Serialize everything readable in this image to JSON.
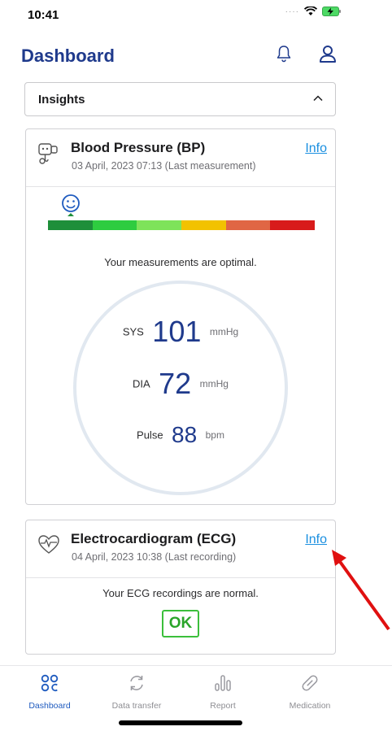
{
  "status": {
    "time": "10:41"
  },
  "header": {
    "title": "Dashboard"
  },
  "insights": {
    "label": "Insights"
  },
  "bp_card": {
    "title": "Blood Pressure (BP)",
    "subtitle": "03 April, 2023 07:13 (Last measurement)",
    "info": "Info",
    "message": "Your measurements are optimal.",
    "scale_colors": [
      "#1e8f3a",
      "#2ecc40",
      "#7ee35a",
      "#f2c200",
      "#e06644",
      "#d81b1b"
    ],
    "scale_level": 0,
    "sys": {
      "label": "SYS",
      "value": "101",
      "unit": "mmHg"
    },
    "dia": {
      "label": "DIA",
      "value": "72",
      "unit": "mmHg"
    },
    "pulse": {
      "label": "Pulse",
      "value": "88",
      "unit": "bpm"
    }
  },
  "ecg_card": {
    "title": "Electrocardiogram (ECG)",
    "subtitle": "04 April, 2023 10:38 (Last recording)",
    "info": "Info",
    "message": "Your ECG recordings are normal.",
    "badge": "OK"
  },
  "tabs": [
    {
      "label": "Dashboard",
      "icon": "dashboard-grid-icon",
      "active": true
    },
    {
      "label": "Data transfer",
      "icon": "sync-icon",
      "active": false
    },
    {
      "label": "Report",
      "icon": "bar-chart-icon",
      "active": false
    },
    {
      "label": "Medication",
      "icon": "pill-icon",
      "active": false
    }
  ],
  "colors": {
    "brand": "#1f3a8c",
    "link": "#1a8fe0",
    "ok": "#2aa52a",
    "annotation_arrow": "#e01010"
  }
}
